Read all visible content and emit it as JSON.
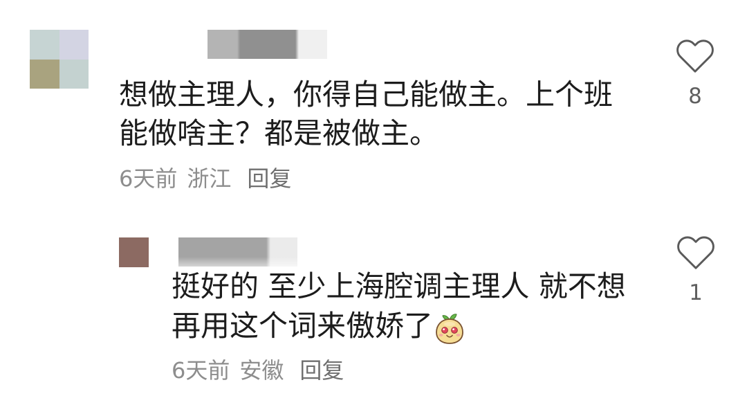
{
  "comments": [
    {
      "text": "想做主理人，你得自己能做主。上个班能做啥主？都是被做主。",
      "time": "6天前",
      "location": "浙江",
      "reply_label": "回复",
      "like_count": "8",
      "like_icon": "heart-outline-icon",
      "replies": [
        {
          "text": "挺好的 至少上海腔调主理人 就不想再用这个词来傲娇了",
          "emoji": "sprout-face-sticker-icon",
          "time": "6天前",
          "location": "安徽",
          "reply_label": "回复",
          "like_count": "1",
          "like_icon": "heart-outline-icon"
        }
      ]
    }
  ],
  "colors": {
    "text": "#1c1c1c",
    "meta": "#8d8d8d",
    "icon": "#5a5a5a"
  }
}
